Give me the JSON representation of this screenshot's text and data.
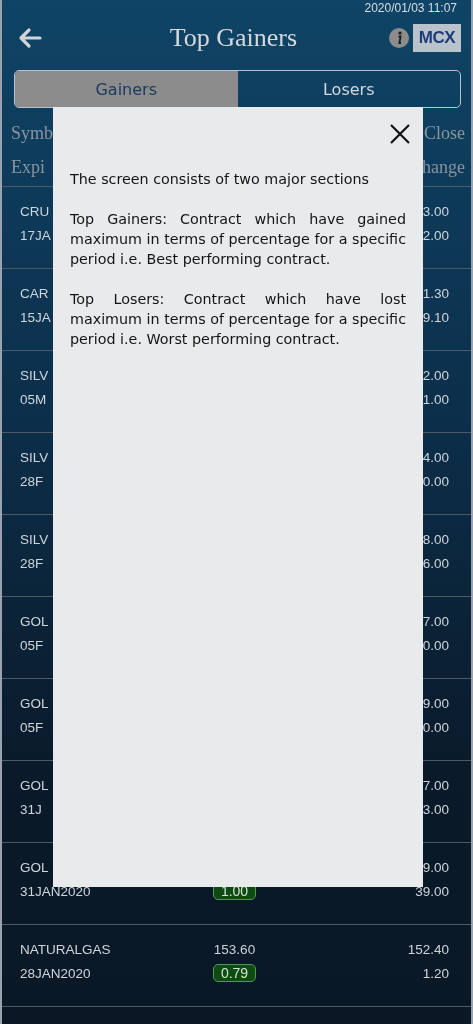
{
  "status_time": "2020/01/03 11:07",
  "header": {
    "title": "Top Gainers",
    "logo": "MCX"
  },
  "tabs": [
    {
      "label": "Gainers",
      "selected": true
    },
    {
      "label": "Losers",
      "selected": false
    }
  ],
  "columns": {
    "row_1": {
      "left": "Symb",
      "right": "Close"
    },
    "row_2": {
      "left": "Expi",
      "right": "hange"
    }
  },
  "rows": [
    {
      "symbol": "CRU",
      "expiry": "17JA",
      "close": "3.00",
      "abs_change": "2.00"
    },
    {
      "symbol": "CAR",
      "expiry": "15JA",
      "close": "1.30",
      "abs_change": "9.10"
    },
    {
      "symbol": "SILV",
      "expiry": "05M",
      "close": "2.00",
      "abs_change": "1.00"
    },
    {
      "symbol": "SILV",
      "expiry": "28F",
      "close": "4.00",
      "abs_change": "0.00"
    },
    {
      "symbol": "SILV",
      "expiry": "28F",
      "close": "8.00",
      "abs_change": "6.00"
    },
    {
      "symbol": "GOL",
      "expiry": "05F",
      "close": "7.00",
      "abs_change": "0.00"
    },
    {
      "symbol": "GOL",
      "expiry": "05F",
      "close": "9.00",
      "abs_change": "0.00"
    },
    {
      "symbol": "GOL",
      "expiry": "31J",
      "close": "7.00",
      "abs_change": "3.00"
    },
    {
      "symbol": "GOL",
      "expiry": "31JAN2020",
      "change": "1.00",
      "close": "9.00",
      "abs_change": "39.00"
    },
    {
      "symbol": "NATURALGAS",
      "expiry": "28JAN2020",
      "ltp": "153.60",
      "change": "0.79",
      "close": "152.40",
      "abs_change": "1.20"
    }
  ],
  "help_dialog": {
    "paragraphs": [
      "The screen consists of two major sections",
      "Top Gainers: Contract which have gained maximum in terms of percentage for a specific period i.e. Best performing contract.",
      "Top Losers: Contract which have lost maximum in terms of percentage for a specific period i.e. Worst performing contract."
    ]
  }
}
